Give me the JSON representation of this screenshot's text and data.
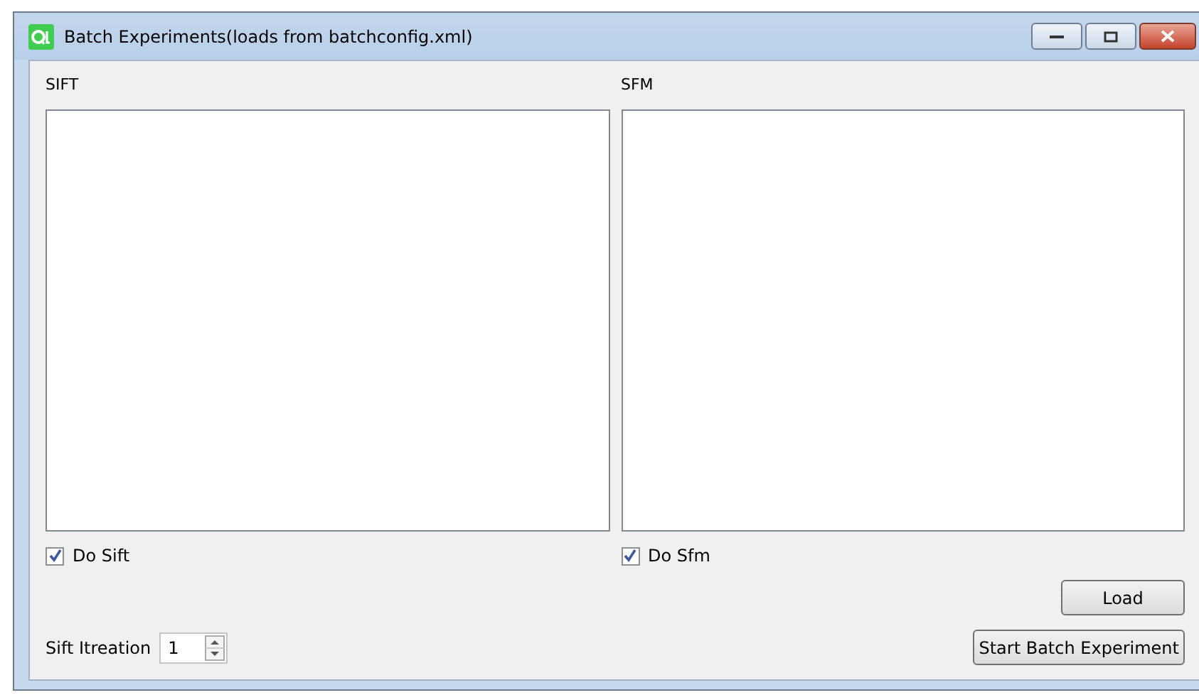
{
  "window": {
    "title": "Batch Experiments(loads from batchconfig.xml)"
  },
  "panels": [
    {
      "label": "SIFT",
      "checkbox": {
        "label": "Do Sift",
        "checked": true
      }
    },
    {
      "label": "SFM",
      "checkbox": {
        "label": "Do Sfm",
        "checked": true
      }
    }
  ],
  "load_button": "Load",
  "iteration": {
    "label": "Sift Itreation",
    "value": "1"
  },
  "start_button": "Start Batch Experiment"
}
